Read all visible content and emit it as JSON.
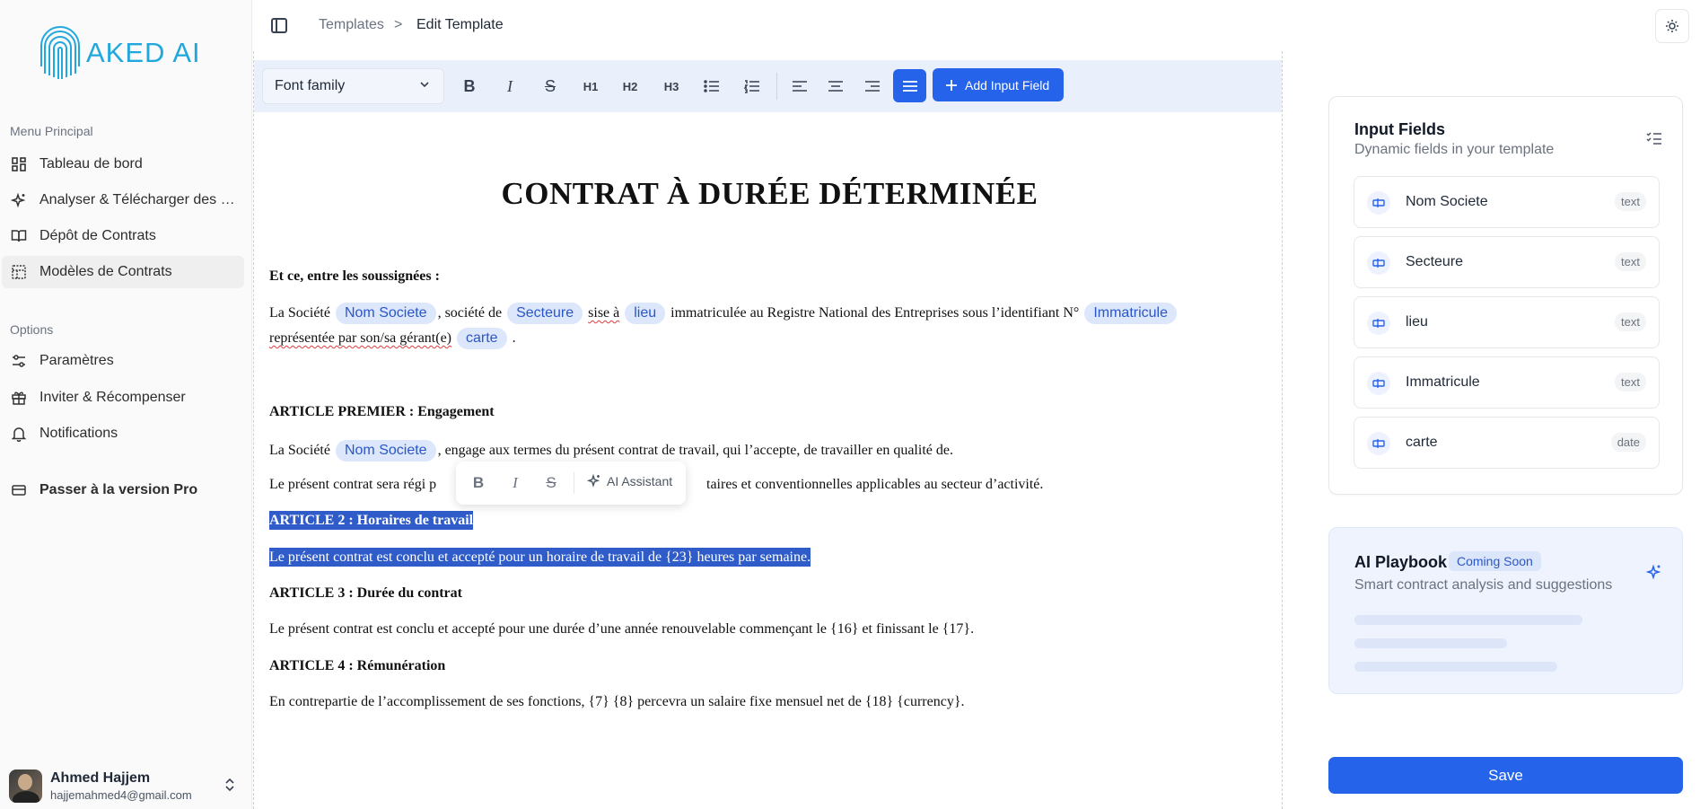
{
  "app": {
    "logo_text": "AKED AI"
  },
  "sidebar": {
    "section_main": "Menu Principal",
    "items": [
      {
        "label": "Tableau de bord"
      },
      {
        "label": "Analyser & Télécharger des …"
      },
      {
        "label": "Dépôt de Contrats"
      },
      {
        "label": "Modèles de Contrats"
      }
    ],
    "section_options": "Options",
    "options": [
      {
        "label": "Paramètres"
      },
      {
        "label": "Inviter & Récompenser"
      },
      {
        "label": "Notifications"
      }
    ],
    "upgrade": "Passer à la version Pro",
    "user": {
      "name": "Ahmed Hajjem",
      "email": "hajjemahmed4@gmail.com"
    }
  },
  "header": {
    "breadcrumb_1": "Templates",
    "breadcrumb_sep": ">",
    "breadcrumb_2": "Edit Template"
  },
  "toolbar": {
    "font_family": "Font family",
    "h1": "H1",
    "h2": "H2",
    "h3": "H3",
    "add_field": "Add Input Field"
  },
  "floating_toolbar": {
    "ai_label": "AI Assistant"
  },
  "document": {
    "title": "CONTRAT À DURÉE DÉTERMINÉE",
    "intro": "Et ce, entre les soussignées :",
    "p1a": "La Société",
    "p1b": ", société de",
    "p1c": "sise à",
    "p1d": "immatriculée au Registre National des Entreprises sous l’identifiant N°",
    "p1e": "représentée par son/sa gérant(e)",
    "p1f": ".",
    "art1_title": "ARTICLE PREMIER : Engagement",
    "art1_p1a": "La Société",
    "art1_p1b": ", engage aux termes du présent contrat de travail, qui l’accepte, de travailler en qualité de.",
    "art1_p2": "Le présent contrat sera régi p",
    "art1_p2b": "taires et conventionnelles applicables au secteur d’activité.",
    "art2_title": "ARTICLE 2 : Horaires de travail",
    "art2_p": "Le présent contrat est conclu et accepté pour un horaire de travail de {23} heures par semaine.",
    "art3_title": "ARTICLE 3 : Durée du contrat",
    "art3_p": "Le présent contrat est conclu et accepté pour une durée d’une année renouvelable commençant le {16} et finissant le {17}.",
    "art4_title": "ARTICLE 4 : Rémunération",
    "art4_p": "En contrepartie de l’accomplissement de ses fonctions, {7} {8} percevra un salaire fixe mensuel net de {18} {currency}.",
    "chips": {
      "nom_societe": "Nom Societe",
      "secteure": "Secteure",
      "lieu": "lieu",
      "immatricule": "Immatricule",
      "carte": "carte"
    }
  },
  "input_fields": {
    "title": "Input Fields",
    "subtitle": "Dynamic fields in your template",
    "fields": [
      {
        "name": "Nom Societe",
        "type": "text"
      },
      {
        "name": "Secteure",
        "type": "text"
      },
      {
        "name": "lieu",
        "type": "text"
      },
      {
        "name": "Immatricule",
        "type": "text"
      },
      {
        "name": "carte",
        "type": "date"
      }
    ]
  },
  "playbook": {
    "title": "AI Playbook",
    "badge": "Coming Soon",
    "subtitle": "Smart contract analysis and suggestions"
  },
  "actions": {
    "save": "Save"
  },
  "colors": {
    "accent": "#2563eb",
    "chip_bg": "#dce7fb",
    "chip_text": "#2b56c7",
    "logo": "#22a7dd"
  }
}
